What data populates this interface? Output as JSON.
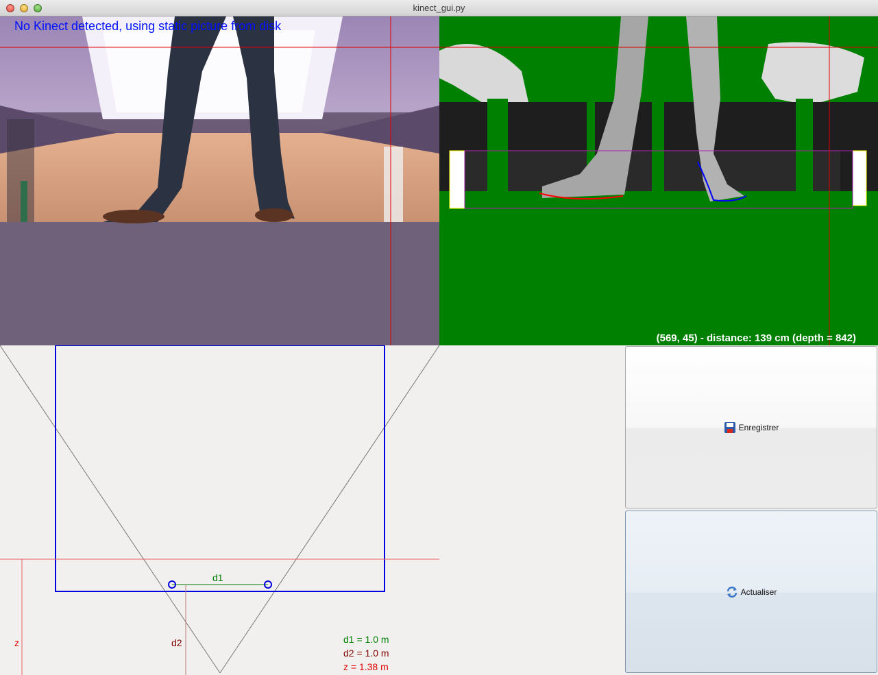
{
  "window": {
    "title": "kinect_gui.py"
  },
  "rgb_view": {
    "status_message": "No Kinect detected, using static picture from disk"
  },
  "depth_view": {
    "readout": "(569, 45) - distance: 139 cm (depth = 842)"
  },
  "plan_view": {
    "labels": {
      "d1": "d1",
      "d2": "d2",
      "z": "z"
    },
    "legend": {
      "d1": "d1 = 1.0 m",
      "d2": "d2 = 1.0 m",
      "z": "z = 1.38 m"
    },
    "colors": {
      "d1": "#008000",
      "d2": "#800000",
      "z": "#e00000",
      "box": "#0000dd"
    }
  },
  "buttons": {
    "save": {
      "label": "Enregistrer",
      "icon": "floppy-disk-icon"
    },
    "refresh": {
      "label": "Actualiser",
      "icon": "refresh-icon"
    }
  }
}
